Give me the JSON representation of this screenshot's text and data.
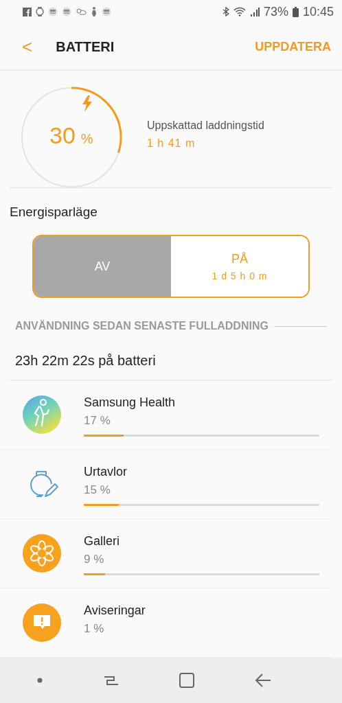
{
  "status_bar": {
    "battery": "73%",
    "time": "10:45"
  },
  "header": {
    "back": "<",
    "title": "BATTERI",
    "action": "UPPDATERA"
  },
  "gauge": {
    "level": 0.3,
    "value": "30",
    "unit": "%",
    "label": "Uppskattad laddningstid",
    "time": "1 h 41 m"
  },
  "power_saving": {
    "title": "Energisparläge",
    "options": [
      {
        "label": "AV",
        "selected": true
      },
      {
        "label": "PÅ",
        "detail": "1 d 5 h 0 m",
        "selected": false
      }
    ]
  },
  "usage": {
    "heading": "ANVÄNDNING SEDAN SENASTE FULLADDNING",
    "duration": "23h 22m 22s på batteri",
    "apps": [
      {
        "kind": "health",
        "name": "Samsung Health",
        "percent": "17 %",
        "level": 0.17
      },
      {
        "kind": "watchface",
        "name": "Urtavlor",
        "percent": "15 %",
        "level": 0.15
      },
      {
        "kind": "gallery",
        "name": "Galleri",
        "percent": "9 %",
        "level": 0.09
      },
      {
        "kind": "notifications",
        "name": "Aviseringar",
        "percent": "1 %"
      }
    ]
  }
}
